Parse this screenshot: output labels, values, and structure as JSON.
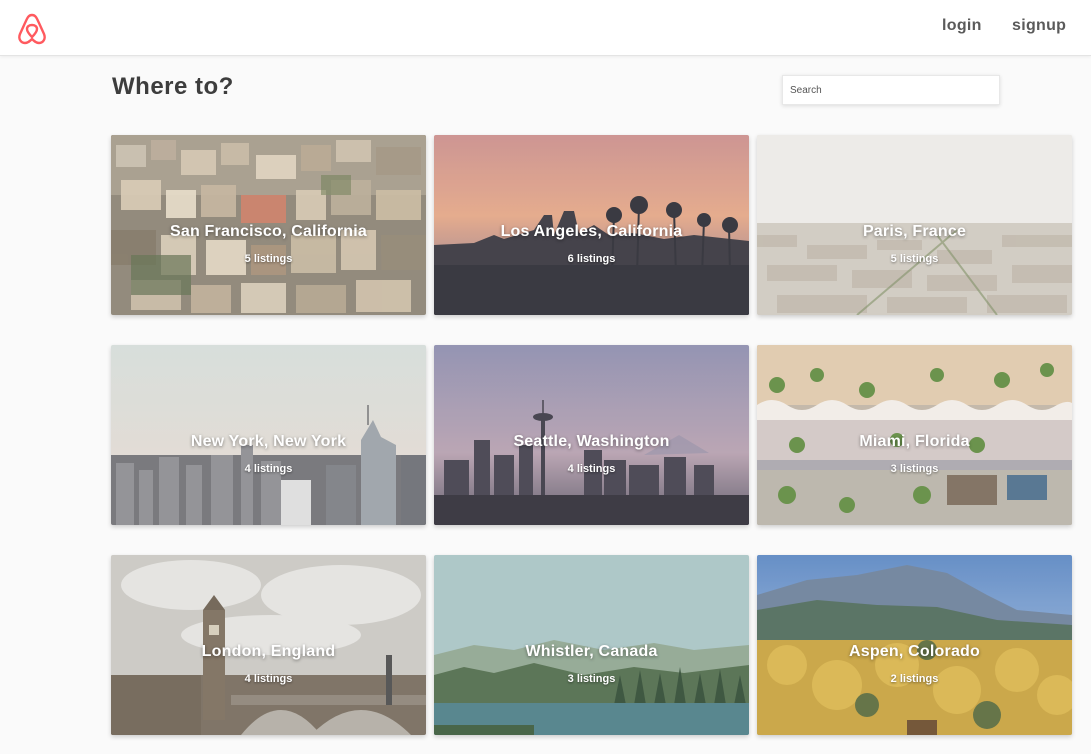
{
  "header": {
    "logo_icon": "airbnb-belo-icon",
    "brand_color": "#ff5a5f",
    "login_label": "login",
    "signup_label": "signup"
  },
  "main": {
    "title": "Where to?",
    "search": {
      "placeholder": "Search",
      "value": ""
    }
  },
  "destinations": [
    {
      "name": "San Francisco, California",
      "listings": "5 listings"
    },
    {
      "name": "Los Angeles, California",
      "listings": "6 listings"
    },
    {
      "name": "Paris, France",
      "listings": "5 listings"
    },
    {
      "name": "New York, New York",
      "listings": "4 listings"
    },
    {
      "name": "Seattle, Washington",
      "listings": "4 listings"
    },
    {
      "name": "Miami, Florida",
      "listings": "3 listings"
    },
    {
      "name": "London, England",
      "listings": "4 listings"
    },
    {
      "name": "Whistler, Canada",
      "listings": "3 listings"
    },
    {
      "name": "Aspen, Colorado",
      "listings": "2 listings"
    }
  ]
}
